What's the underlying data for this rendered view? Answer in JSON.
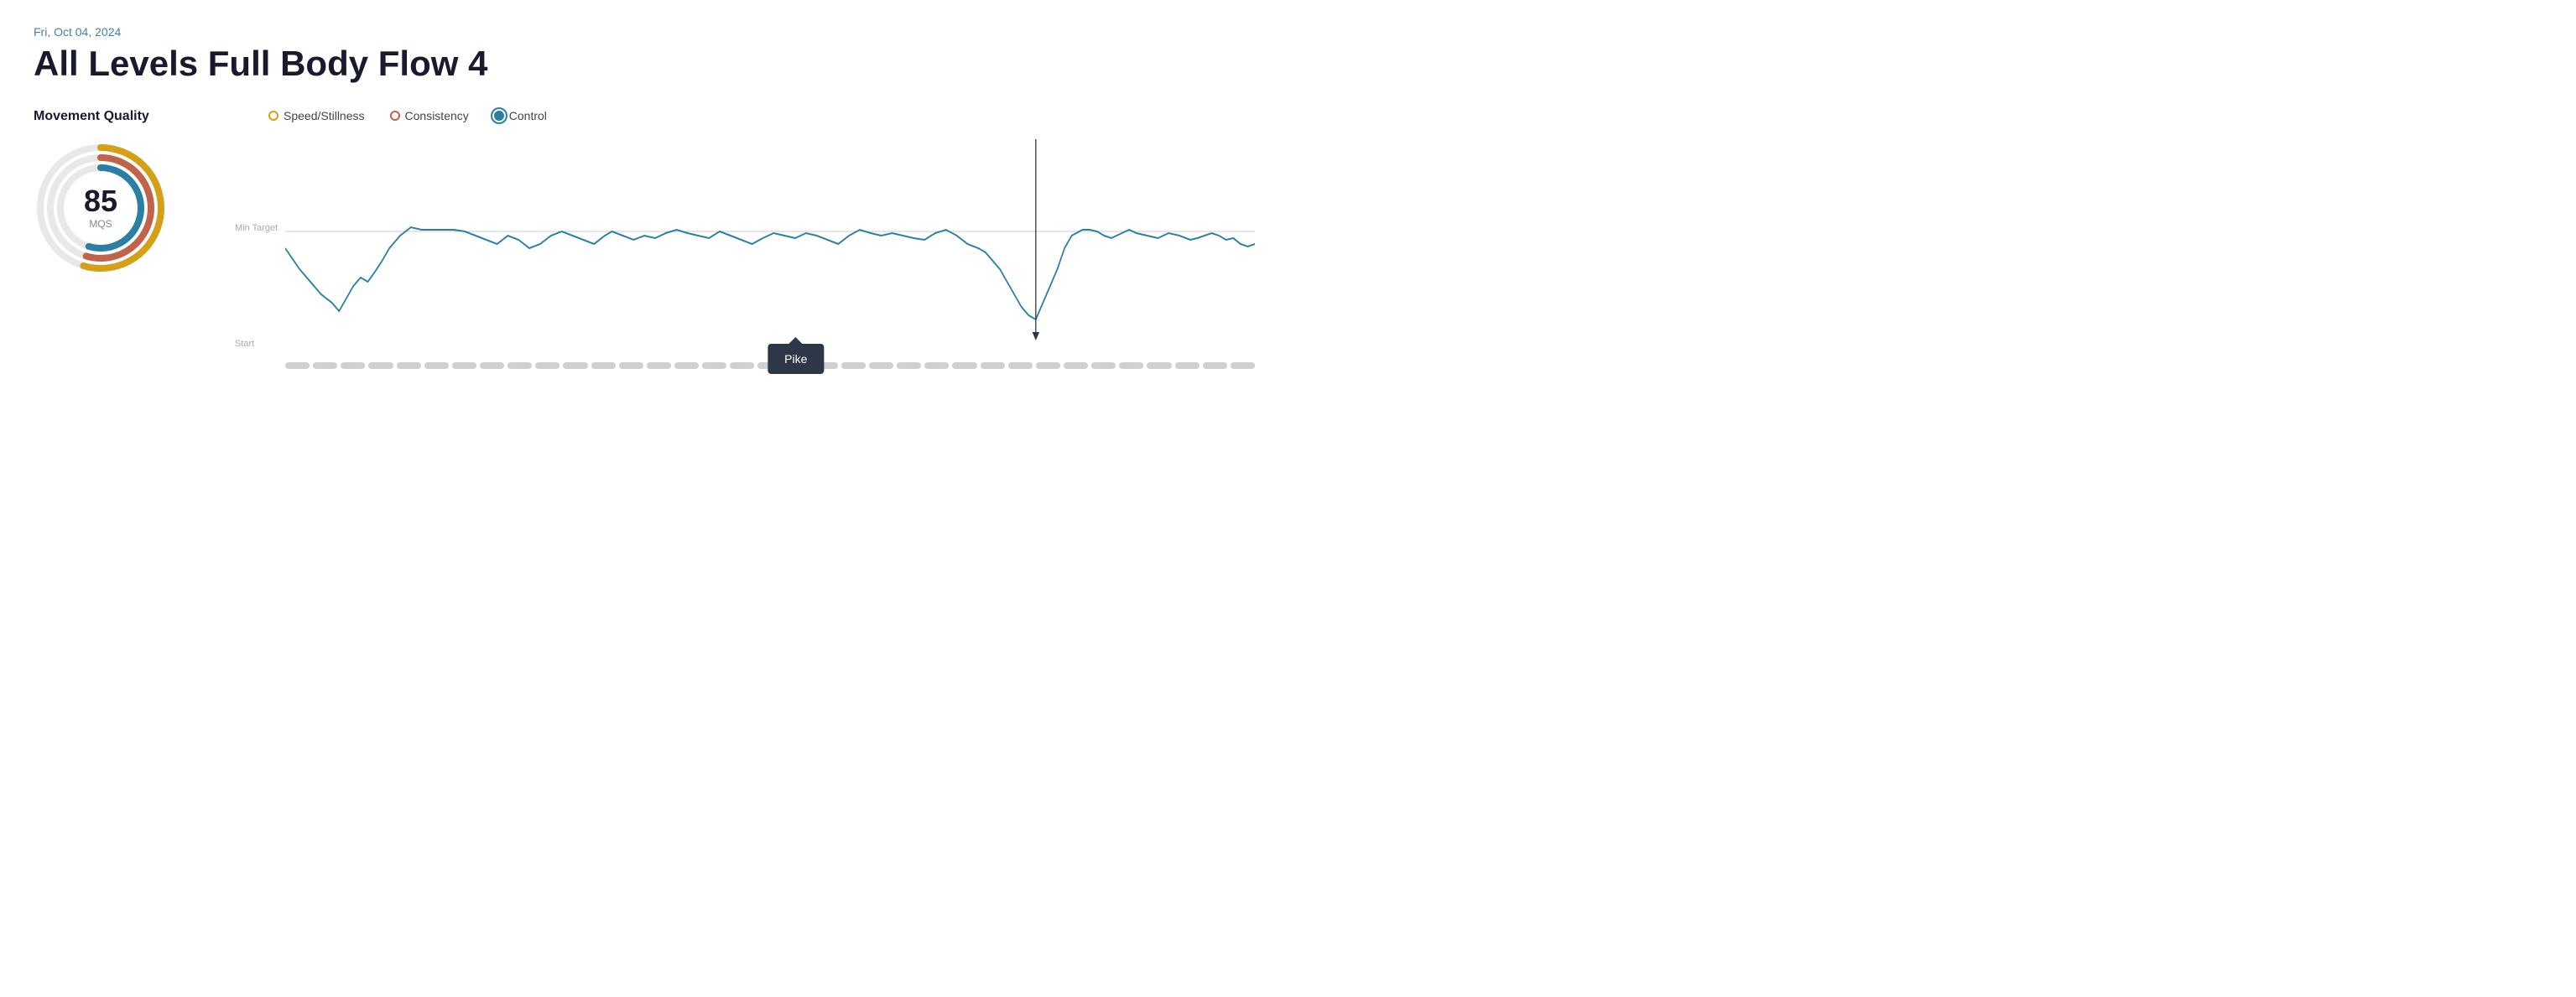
{
  "header": {
    "date": "Fri, Oct 04, 2024",
    "title": "All Levels Full Body Flow 4"
  },
  "section": {
    "label": "Movement Quality"
  },
  "gauge": {
    "value": "85",
    "unit": "MQS"
  },
  "legend": {
    "items": [
      {
        "id": "speed",
        "label": "Speed/Stillness",
        "color": "#d4a017",
        "type": "circle"
      },
      {
        "id": "consistency",
        "label": "Consistency",
        "color": "#c0634a",
        "type": "circle"
      },
      {
        "id": "control",
        "label": "Control",
        "color": "#2a7fa5",
        "type": "filled"
      }
    ]
  },
  "chart": {
    "minTargetLabel": "Min Target",
    "startLabel": "Start"
  },
  "tooltip": {
    "label": "Pike"
  },
  "colors": {
    "speed": "#d4a017",
    "consistency": "#c0634a",
    "control": "#2a7fa5",
    "chartLine": "#2a7fa5",
    "targetLine": "#cccccc",
    "timeline": "#cccccc",
    "tooltipBg": "#2d3748"
  }
}
